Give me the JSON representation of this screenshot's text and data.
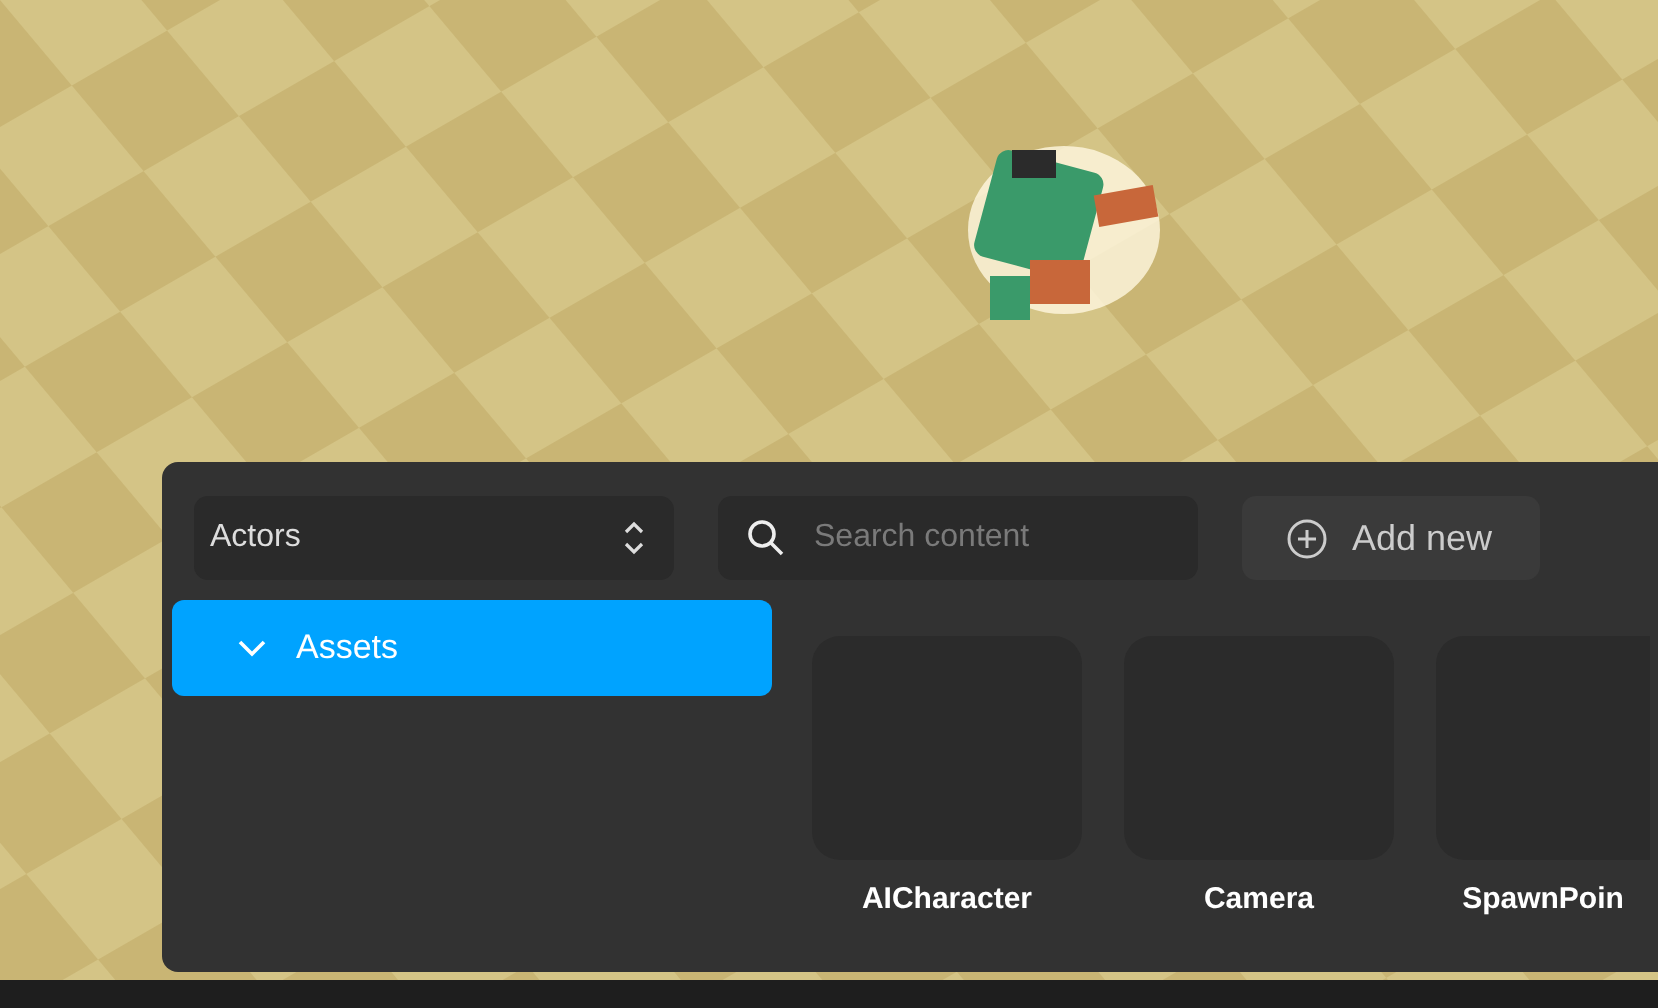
{
  "toolbar": {
    "category_select": {
      "value": "Actors"
    },
    "search": {
      "placeholder": "Search content"
    },
    "add_button": {
      "label": "Add new"
    }
  },
  "tree": [
    {
      "label": "Assets",
      "expanded": true,
      "selected": true
    }
  ],
  "assets": [
    {
      "label": "AICharacter"
    },
    {
      "label": "Camera"
    },
    {
      "label": "SpawnPoin"
    }
  ]
}
